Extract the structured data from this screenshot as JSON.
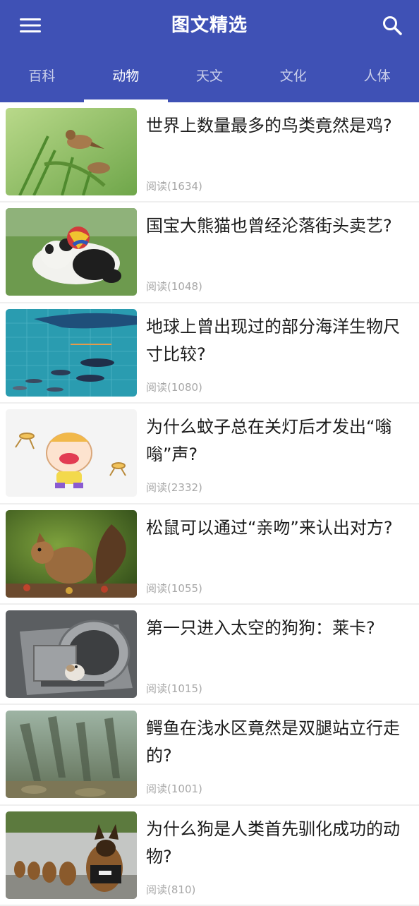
{
  "app": {
    "title": "图文精选"
  },
  "tabs": [
    {
      "label": "百科",
      "active": false
    },
    {
      "label": "动物",
      "active": true
    },
    {
      "label": "天文",
      "active": false
    },
    {
      "label": "文化",
      "active": false
    },
    {
      "label": "人体",
      "active": false
    }
  ],
  "meta_label": "阅读",
  "articles": [
    {
      "title": "世界上数量最多的鸟类竟然是鸡?",
      "reads": "(1634)",
      "thumb": "bird-on-plant"
    },
    {
      "title": "国宝大熊猫也曾经沦落街头卖艺?",
      "reads": "(1048)",
      "thumb": "panda-with-ball"
    },
    {
      "title": "地球上曾出现过的部分海洋生物尺寸比较?",
      "reads": "(1080)",
      "thumb": "sea-creatures-size"
    },
    {
      "title": "为什么蚊子总在关灯后才发出“嗡嗡”声?",
      "reads": "(2332)",
      "thumb": "mosquito-cartoon"
    },
    {
      "title": "松鼠可以通过“亲吻”来认出对方?",
      "reads": "(1055)",
      "thumb": "squirrel"
    },
    {
      "title": "第一只进入太空的狗狗：莱卡?",
      "reads": "(1015)",
      "thumb": "space-dog-capsule"
    },
    {
      "title": "鳄鱼在浅水区竟然是双腿站立行走的?",
      "reads": "(1001)",
      "thumb": "crocodiles-underwater"
    },
    {
      "title": "为什么狗是人类首先驯化成功的动物?",
      "reads": "(810)",
      "thumb": "police-dogs"
    }
  ],
  "colors": {
    "primary": "#3f51b5",
    "text": "#1b1b1b",
    "meta": "#a8a8a8"
  }
}
